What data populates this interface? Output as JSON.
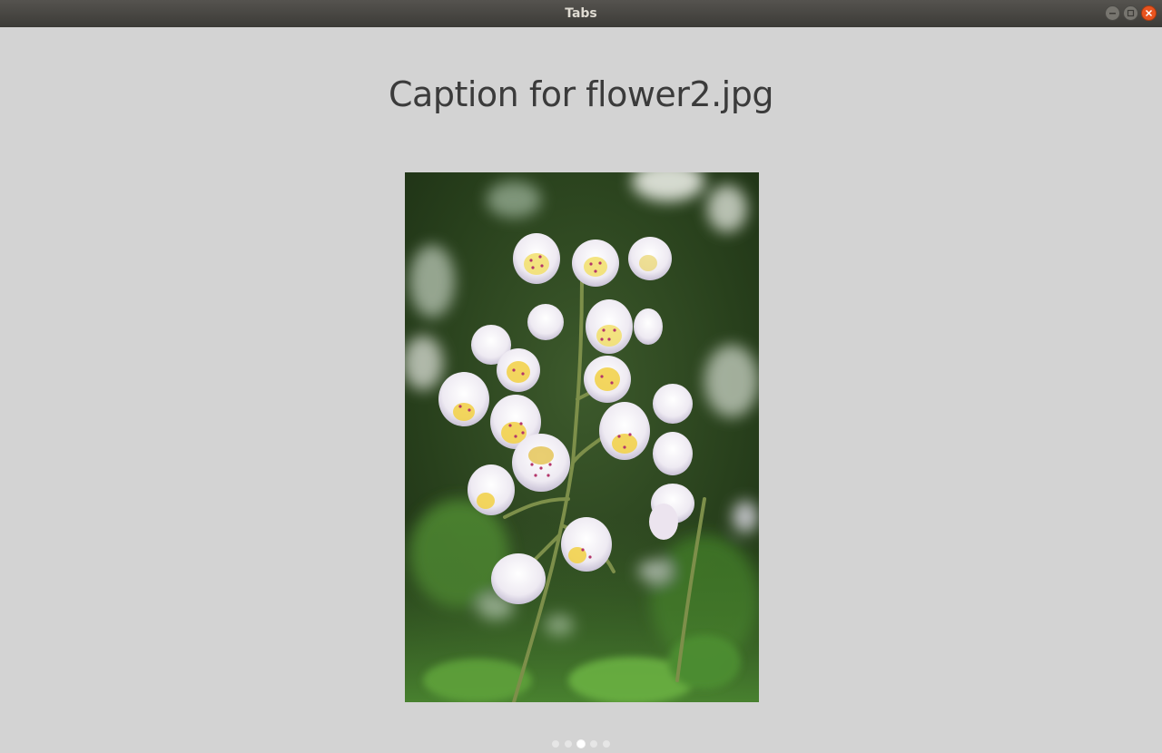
{
  "window": {
    "title": "Tabs"
  },
  "controls": {
    "minimize_icon": "minimize-icon",
    "maximize_icon": "maximize-icon",
    "close_icon": "close-icon"
  },
  "slide": {
    "caption": "Caption for flower2.jpg",
    "image_subject": "white spotted bell-shaped flowers on green stem"
  },
  "pagination": {
    "count": 5,
    "active_index": 2
  },
  "colors": {
    "background": "#d3d3d3",
    "titlebar": "#3c3b37",
    "close_button": "#e9541f",
    "caption_text": "#3b3b3b"
  }
}
